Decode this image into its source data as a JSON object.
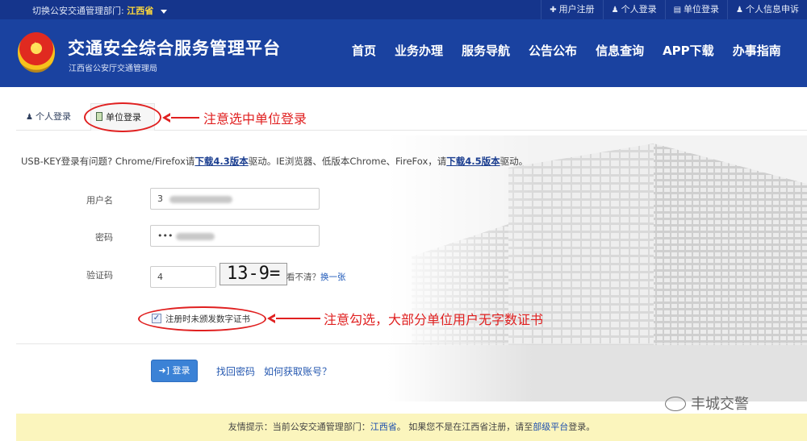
{
  "topbar": {
    "switch_label": "切换公安交通管理部门:",
    "province": "江西省",
    "links": [
      {
        "icon": "plus-icon",
        "label": "用户注册"
      },
      {
        "icon": "user-icon",
        "label": "个人登录"
      },
      {
        "icon": "building-icon",
        "label": "单位登录"
      },
      {
        "icon": "user-icon",
        "label": "个人信息申诉"
      }
    ]
  },
  "header": {
    "title": "交通安全综合服务管理平台",
    "subtitle": "江西省公安厅交通管理局",
    "nav": [
      "首页",
      "业务办理",
      "服务导航",
      "公告公布",
      "信息查询",
      "APP下载",
      "办事指南"
    ]
  },
  "tabs": {
    "personal": "个人登录",
    "unit": "单位登录"
  },
  "annotations": {
    "unit_tab_note": "注意选中单位登录",
    "checkbox_note": "注意勾选，大部分单位用户无字数证书"
  },
  "usb_note": {
    "part1": "USB-KEY登录有问题? Chrome/Firefox请",
    "link1": "下载4.3版本",
    "part2": "驱动。IE浏览器、低版本Chrome、FireFox，请",
    "link2": "下载4.5版本",
    "part3": "驱动。"
  },
  "form": {
    "username_label": "用户名",
    "username_value": "3",
    "password_label": "密码",
    "password_value": "•••",
    "captcha_label": "验证码",
    "captcha_value": "4",
    "captcha_image_text": "13-9=",
    "cant_see": "看不清？",
    "change_one": "换一张",
    "checkbox_label": "注册时未颁发数字证书",
    "checkbox_checked": true,
    "login_button": "登录",
    "forgot_password": "找回密码",
    "how_to_get_account": "如何获取账号？"
  },
  "watermark": "丰城交警",
  "tip": {
    "prefix": "友情提示：当前公安交通管理部门：",
    "province": "江西省",
    "middle": "。 如果您不是在江西省注册，请至",
    "link": "部级平台",
    "suffix": "登录。"
  },
  "colors": {
    "header_bg": "#1a42a0",
    "topbar_bg": "#15358c",
    "annotation_red": "#e02020",
    "login_button": "#3b82d6",
    "tip_bg": "#fbf5bd"
  }
}
